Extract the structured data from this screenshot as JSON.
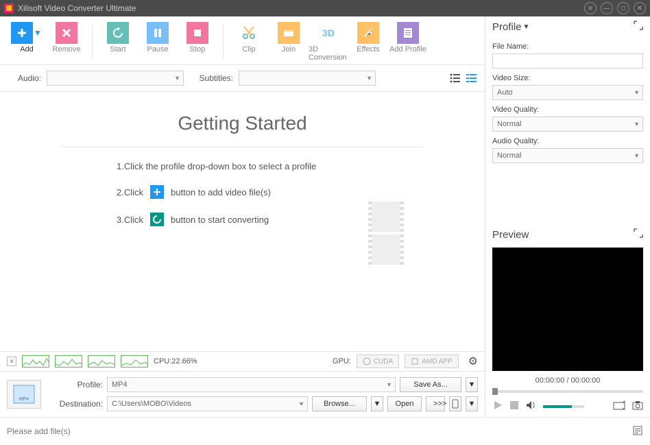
{
  "title": "Xilisoft Video Converter Ultimate",
  "toolbar": {
    "add": "Add",
    "remove": "Remove",
    "start": "Start",
    "pause": "Pause",
    "stop": "Stop",
    "clip": "Clip",
    "join": "Join",
    "conv3d": "3D Conversion",
    "effects": "Effects",
    "addProfile": "Add Profile"
  },
  "filters": {
    "audioLabel": "Audio:",
    "subtitlesLabel": "Subtitles:"
  },
  "gettingStarted": {
    "title": "Getting Started",
    "step1": "1.Click the profile drop-down box to select a profile",
    "step2a": "2.Click",
    "step2b": "button to add video file(s)",
    "step3a": "3.Click",
    "step3b": "button to start converting"
  },
  "perf": {
    "cpuLabel": "CPU:22.66%",
    "gpuLabel": "GPU:",
    "cuda": "CUDA",
    "amd": "AMD APP"
  },
  "bottom": {
    "profileLabel": "Profile:",
    "profileValue": "MP4",
    "destLabel": "Destination:",
    "destValue": "C:\\Users\\MOBO\\Videos",
    "saveAs": "Save As...",
    "browse": "Browse...",
    "open": "Open",
    "go": ">>>"
  },
  "status": "Please add file(s)",
  "profilePanel": {
    "header": "Profile",
    "fileName": "File Name:",
    "videoSize": "Video Size:",
    "videoSizeValue": "Auto",
    "videoQuality": "Video Quality:",
    "videoQualityValue": "Normal",
    "audioQuality": "Audio Quality:",
    "audioQualityValue": "Normal"
  },
  "preview": {
    "header": "Preview",
    "time": "00:00:00 / 00:00:00"
  }
}
